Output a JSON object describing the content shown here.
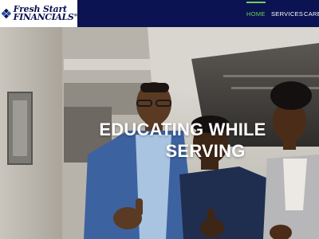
{
  "brand": {
    "line1": "Fresh Start",
    "line2": "FINANCIALS",
    "registered": "®",
    "icon": "diamond-logo-icon",
    "colors": {
      "navy": "#0b1352",
      "blue": "#2a4fa8"
    }
  },
  "nav": {
    "items": [
      {
        "label": "HOME",
        "active": true
      },
      {
        "label": "SERVICES",
        "active": false
      },
      {
        "label": "CAREERS",
        "active": false
      }
    ],
    "active_color": "#6cd15a",
    "bar_color": "#0b1352"
  },
  "hero": {
    "title_line1": "EDUCATING WHILE",
    "title_line2": "SERVING"
  }
}
